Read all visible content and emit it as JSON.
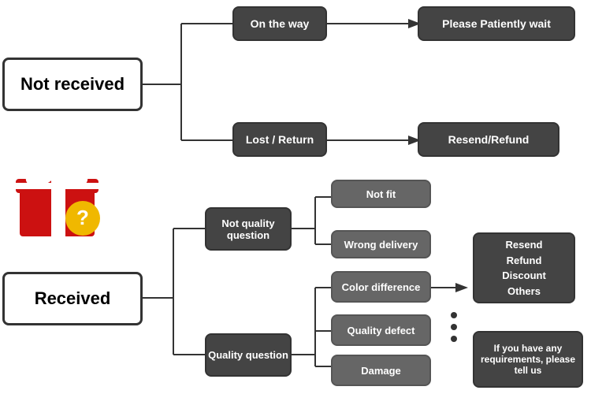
{
  "nodes": {
    "not_received": {
      "label": "Not received"
    },
    "on_the_way": {
      "label": "On the way"
    },
    "please_wait": {
      "label": "Please Patiently wait"
    },
    "lost_return": {
      "label": "Lost / Return"
    },
    "resend_refund": {
      "label": "Resend/Refund"
    },
    "received": {
      "label": "Received"
    },
    "not_quality": {
      "label": "Not quality question"
    },
    "not_fit": {
      "label": "Not fit"
    },
    "wrong_delivery": {
      "label": "Wrong delivery"
    },
    "quality_question": {
      "label": "Quality question"
    },
    "color_diff": {
      "label": "Color difference"
    },
    "quality_defect": {
      "label": "Quality defect"
    },
    "damage": {
      "label": "Damage"
    },
    "resolution": {
      "label": "Resend\nRefund\nDiscount\nOthers"
    },
    "requirements": {
      "label": "If you have any requirements, please tell us"
    }
  }
}
